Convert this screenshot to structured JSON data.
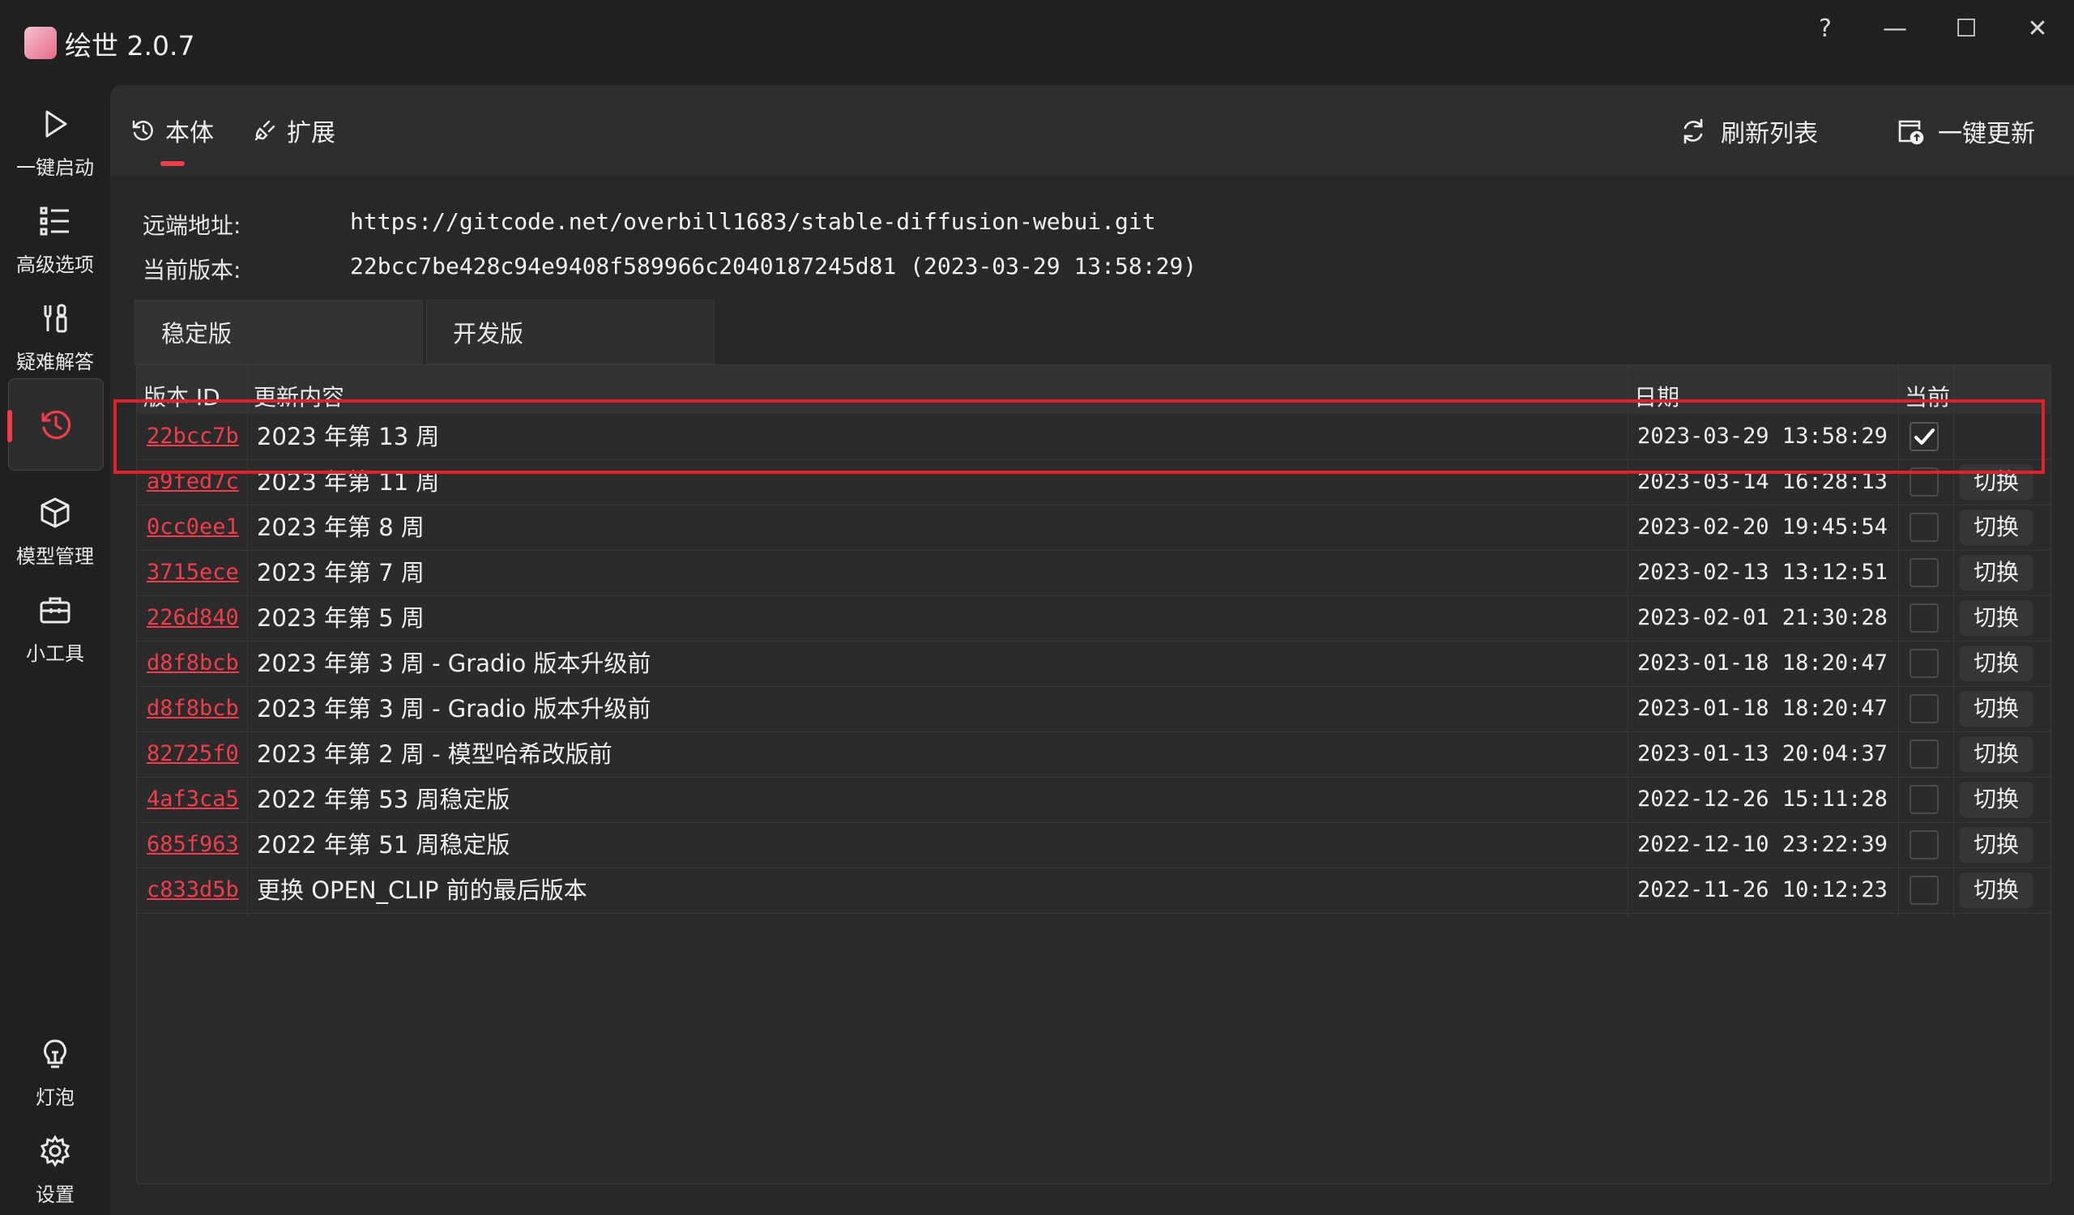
{
  "app": {
    "title": "绘世 2.0.7"
  },
  "window_controls": {
    "help": "?",
    "minimize": "—",
    "maximize": "☐",
    "close": "✕"
  },
  "sidebar": {
    "items": [
      {
        "label": "一键启动",
        "icon": "play-icon"
      },
      {
        "label": "高级选项",
        "icon": "list-icon"
      },
      {
        "label": "疑难解答",
        "icon": "tools-icon"
      },
      {
        "label": "",
        "icon": "history-icon",
        "active": true
      },
      {
        "label": "模型管理",
        "icon": "cube-icon"
      },
      {
        "label": "小工具",
        "icon": "toolbox-icon"
      }
    ],
    "bottom": [
      {
        "label": "灯泡",
        "icon": "lightbulb-icon"
      },
      {
        "label": "设置",
        "icon": "gear-icon"
      }
    ]
  },
  "topbar": {
    "tabs": [
      {
        "label": "本体",
        "active": true
      },
      {
        "label": "扩展"
      }
    ],
    "refresh_label": "刷新列表",
    "update_label": "一键更新"
  },
  "info": {
    "remote_label": "远端地址:",
    "remote_value": "https://gitcode.net/overbill1683/stable-diffusion-webui.git",
    "current_label": "当前版本:",
    "current_value": "22bcc7be428c94e9408f589966c2040187245d81 (2023-03-29 13:58:29)"
  },
  "version_tabs": [
    {
      "label": "稳定版",
      "active": true
    },
    {
      "label": "开发版"
    }
  ],
  "table": {
    "headers": {
      "id": "版本 ID",
      "desc": "更新内容",
      "date": "日期",
      "current": "当前"
    },
    "switch_label": "切换",
    "rows": [
      {
        "id": "22bcc7b",
        "desc": "2023 年第 13 周",
        "date": "2023-03-29 13:58:29",
        "current": true
      },
      {
        "id": "a9fed7c",
        "desc": "2023 年第 11 周",
        "date": "2023-03-14 16:28:13",
        "current": false
      },
      {
        "id": "0cc0ee1",
        "desc": "2023 年第 8 周",
        "date": "2023-02-20 19:45:54",
        "current": false
      },
      {
        "id": "3715ece",
        "desc": "2023 年第 7 周",
        "date": "2023-02-13 13:12:51",
        "current": false
      },
      {
        "id": "226d840",
        "desc": "2023 年第 5 周",
        "date": "2023-02-01 21:30:28",
        "current": false
      },
      {
        "id": "d8f8bcb",
        "desc": "2023 年第 3 周 - Gradio 版本升级前",
        "date": "2023-01-18 18:20:47",
        "current": false
      },
      {
        "id": "d8f8bcb",
        "desc": "2023 年第 3 周 - Gradio 版本升级前",
        "date": "2023-01-18 18:20:47",
        "current": false
      },
      {
        "id": "82725f0",
        "desc": "2023 年第 2 周 - 模型哈希改版前",
        "date": "2023-01-13 20:04:37",
        "current": false
      },
      {
        "id": "4af3ca5",
        "desc": "2022 年第 53 周稳定版",
        "date": "2022-12-26 15:11:28",
        "current": false
      },
      {
        "id": "685f963",
        "desc": "2022 年第 51 周稳定版",
        "date": "2022-12-10 23:22:39",
        "current": false
      },
      {
        "id": "c833d5b",
        "desc": "更换 OPEN_CLIP 前的最后版本",
        "date": "2022-11-26 10:12:23",
        "current": false
      }
    ]
  },
  "colors": {
    "accent": "#ef3d4c",
    "highlight_box": "#e3202a"
  }
}
